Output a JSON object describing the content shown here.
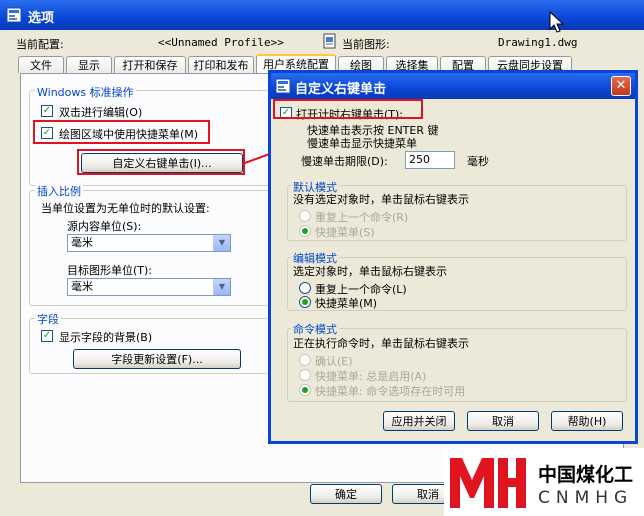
{
  "window": {
    "title": "选项"
  },
  "profile": {
    "label": "当前配置:",
    "value": "<<Unnamed Profile>>"
  },
  "drawing": {
    "label": "当前图形:",
    "value": "Drawing1.dwg"
  },
  "tabs": [
    {
      "label": "文件"
    },
    {
      "label": "显示"
    },
    {
      "label": "打开和保存"
    },
    {
      "label": "打印和发布"
    },
    {
      "label": "用户系统配置"
    },
    {
      "label": "绘图"
    },
    {
      "label": "选择集"
    },
    {
      "label": "配置"
    },
    {
      "label": "云盘同步设置"
    }
  ],
  "windows_ops": {
    "title": "Windows 标准操作",
    "double_click": "双击进行编辑(O)",
    "shortcut_menu": "绘图区域中使用快捷菜单(M)",
    "custom_button": "自定义右键单击(I)..."
  },
  "insert_scale": {
    "title": "插入比例",
    "desc": "当单位设置为无单位时的默认设置:",
    "source_label": "源内容单位(S):",
    "source_value": "毫米",
    "target_label": "目标图形单位(T):",
    "target_value": "毫米"
  },
  "fields": {
    "title": "字段",
    "show_bg": "显示字段的背景(B)",
    "update_button": "字段更新设置(F)..."
  },
  "bottom": {
    "ok": "确定",
    "cancel": "取消"
  },
  "dialog": {
    "title": "自定义右键单击",
    "timed_right_click": "打开计时右键单击(T):",
    "quick_click": "快速单击表示按 ENTER 键",
    "slow_click": "慢速单击显示快捷菜单",
    "delay_label": "慢速单击期限(D):",
    "delay_value": "250",
    "delay_unit": "毫秒",
    "default_mode": {
      "title": "默认模式",
      "desc": "没有选定对象时，单击鼠标右键表示",
      "repeat": "重复上一个命令(R)",
      "menu": "快捷菜单(S)"
    },
    "edit_mode": {
      "title": "编辑模式",
      "desc": "选定对象时，单击鼠标右键表示",
      "repeat": "重复上一个命令(L)",
      "menu": "快捷菜单(M)"
    },
    "command_mode": {
      "title": "命令模式",
      "desc": "正在执行命令时，单击鼠标右键表示",
      "enter": "确认(E)",
      "menu_always": "快捷菜单: 总是启用(A)",
      "menu_options": "快捷菜单: 命令选项存在时可用"
    },
    "apply_close": "应用并关闭",
    "cancel": "取消",
    "help": "帮助(H)"
  },
  "watermark": {
    "name_cn": "中国煤化工",
    "name_en": "CNMHG"
  },
  "colors": {
    "title_blue": "#0a46d6",
    "highlight_red": "#e0141e",
    "check_green": "#21a121",
    "group_blue": "#0046d5"
  }
}
